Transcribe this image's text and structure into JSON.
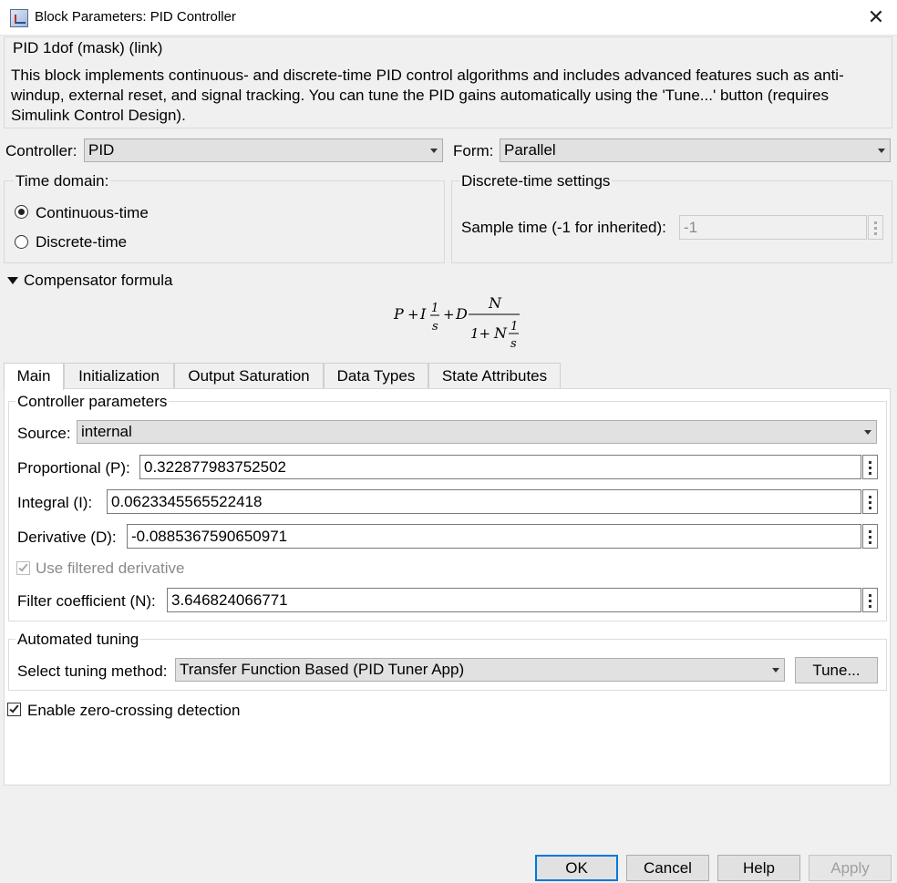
{
  "window": {
    "title": "Block Parameters: PID Controller"
  },
  "mask": {
    "name": "PID 1dof (mask) (link)",
    "description": "This block implements continuous- and discrete-time PID control algorithms and includes advanced features such as anti-windup, external reset, and signal tracking. You can tune the PID gains automatically using the 'Tune...' button (requires Simulink Control Design)."
  },
  "controller": {
    "label": "Controller:",
    "value": "PID"
  },
  "form": {
    "label": "Form:",
    "value": "Parallel"
  },
  "time_domain": {
    "label": "Time domain:",
    "options": [
      "Continuous-time",
      "Discrete-time"
    ],
    "selected": "Continuous-time"
  },
  "discrete_settings": {
    "label": "Discrete-time settings",
    "sample_time_label": "Sample time (-1 for inherited):",
    "sample_time_value": "-1"
  },
  "compensator": {
    "label": "Compensator formula",
    "formula": {
      "p": "P",
      "plus": "+",
      "i": "I",
      "one": "1",
      "s": "s",
      "d": "D",
      "n": "N",
      "denom_prefix": "1+"
    }
  },
  "tabs": [
    {
      "label": "Main",
      "active": true
    },
    {
      "label": "Initialization",
      "active": false
    },
    {
      "label": "Output Saturation",
      "active": false
    },
    {
      "label": "Data Types",
      "active": false
    },
    {
      "label": "State Attributes",
      "active": false
    }
  ],
  "controller_parameters": {
    "label": "Controller parameters",
    "source_label": "Source:",
    "source_value": "internal",
    "proportional_label": "Proportional (P):",
    "proportional_value": "0.322877983752502",
    "integral_label": "Integral (I):",
    "integral_value": "0.0623345565522418",
    "derivative_label": "Derivative (D):",
    "derivative_value": "-0.0885367590650971",
    "filtered_derivative_label": "Use filtered derivative",
    "filter_label": "Filter coefficient (N):",
    "filter_value": "3.646824066771"
  },
  "automated_tuning": {
    "label": "Automated tuning",
    "method_label": "Select tuning method:",
    "method_value": "Transfer Function Based (PID Tuner App)",
    "tune_button": "Tune..."
  },
  "zero_crossing": {
    "label": "Enable zero-crossing detection"
  },
  "buttons": {
    "ok": "OK",
    "cancel": "Cancel",
    "help": "Help",
    "apply": "Apply"
  },
  "colors": {
    "accent": "#0078d7",
    "window_bg": "#f0f0f0",
    "panel_bg": "#ffffff"
  }
}
